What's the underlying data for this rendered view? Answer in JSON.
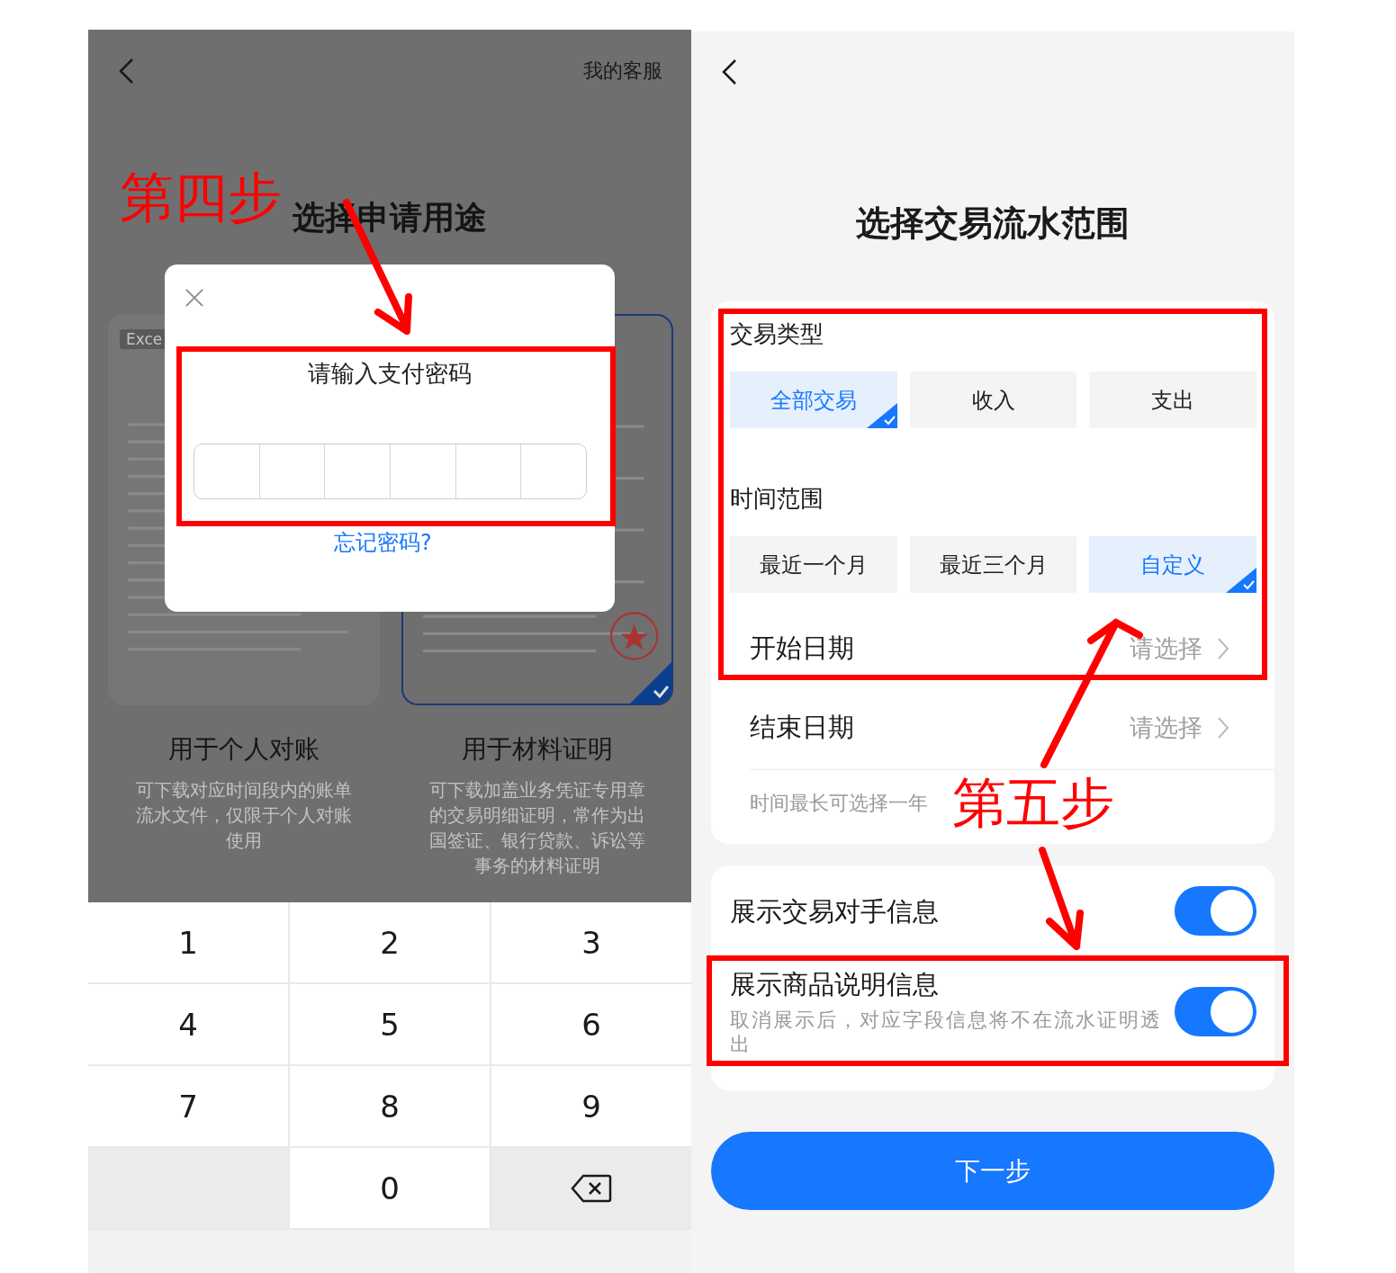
{
  "left_screen": {
    "header": {
      "service_link": "我的客服"
    },
    "title": "选择申请用途",
    "purpose_cards": [
      {
        "tag": "Exce",
        "title": "用于个人对账",
        "description": "可下载对应时间段内的账单流水文件，仅限于个人对账使用",
        "selected": false
      },
      {
        "title": "用于材料证明",
        "description": "可下载加盖业务凭证专用章的交易明细证明，常作为出国签证、银行贷款、诉讼等事务的材料证明",
        "selected": true
      }
    ],
    "password_dialog": {
      "title": "请输入支付密码",
      "forgot_link": "忘记密码?"
    },
    "keypad": [
      {
        "kind": "digit",
        "label": "1"
      },
      {
        "kind": "digit",
        "label": "2"
      },
      {
        "kind": "digit",
        "label": "3"
      },
      {
        "kind": "digit",
        "label": "4"
      },
      {
        "kind": "digit",
        "label": "5"
      },
      {
        "kind": "digit",
        "label": "6"
      },
      {
        "kind": "digit",
        "label": "7"
      },
      {
        "kind": "digit",
        "label": "8"
      },
      {
        "kind": "digit",
        "label": "9"
      },
      {
        "kind": "blank"
      },
      {
        "kind": "digit",
        "label": "0"
      },
      {
        "kind": "backspace"
      }
    ]
  },
  "right_screen": {
    "title": "选择交易流水范围",
    "transaction_type": {
      "label": "交易类型",
      "options": [
        {
          "label": "全部交易",
          "selected": true
        },
        {
          "label": "收入",
          "selected": false
        },
        {
          "label": "支出",
          "selected": false
        }
      ]
    },
    "time_range": {
      "label": "时间范围",
      "options": [
        {
          "label": "最近一个月",
          "selected": false
        },
        {
          "label": "最近三个月",
          "selected": false
        },
        {
          "label": "自定义",
          "selected": true
        }
      ]
    },
    "date_rows": [
      {
        "label": "开始日期",
        "value": "请选择"
      },
      {
        "label": "结束日期",
        "value": "请选择"
      }
    ],
    "hint": "时间最长可选择一年",
    "toggles": [
      {
        "label": "展示交易对手信息",
        "on": true
      },
      {
        "label": "展示商品说明信息",
        "description": "取消展示后，对应字段信息将不在流水证明透出",
        "on": true
      }
    ],
    "next_button": "下一步"
  },
  "annotations": [
    {
      "kind": "step-label",
      "text": "第四步"
    },
    {
      "kind": "step-label",
      "text": "第五步"
    }
  ]
}
